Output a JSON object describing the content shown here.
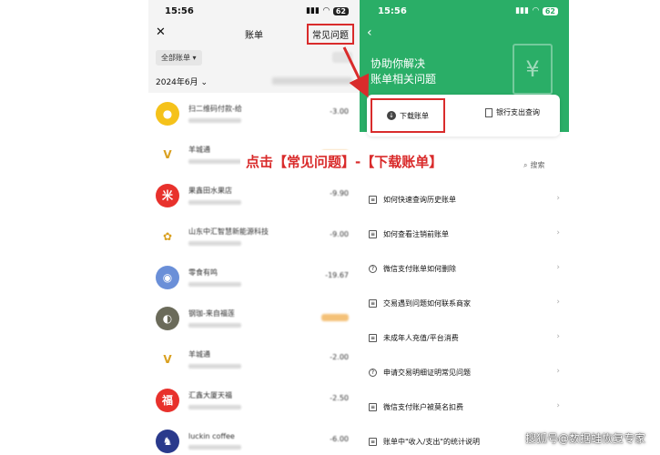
{
  "left_phone": {
    "time": "15:56",
    "battery": "62",
    "title": "账单",
    "faq_button": "常见问题",
    "filter_label": "全部账单",
    "month_label": "2024年6月",
    "transactions": [
      {
        "name": "扫二维码付款-给",
        "amount": "-3.00",
        "avatar_color": "#f5c21a",
        "avatar_glyph": "●"
      },
      {
        "name": "羊城通",
        "amount": "",
        "avatar_color": "#ffffff",
        "avatar_glyph": "V"
      },
      {
        "name": "果鑫田水果店",
        "amount": "-9.90",
        "avatar_color": "#e8312c",
        "avatar_glyph": "米"
      },
      {
        "name": "山东中汇智慧新能源科技",
        "amount": "-9.00",
        "avatar_color": "#ffffff",
        "avatar_glyph": "✿"
      },
      {
        "name": "零食有鸣",
        "amount": "-19.67",
        "avatar_color": "#6a8fd8",
        "avatar_glyph": "◉"
      },
      {
        "name": "钢珈-来自福莲",
        "amount": "",
        "avatar_color": "#6b6b5a",
        "avatar_glyph": "◐"
      },
      {
        "name": "羊城通",
        "amount": "-2.00",
        "avatar_color": "#ffffff",
        "avatar_glyph": "V"
      },
      {
        "name": "汇鑫大厦天福",
        "amount": "-2.50",
        "avatar_color": "#e8312c",
        "avatar_glyph": "福"
      },
      {
        "name": "luckin coffee",
        "amount": "-6.00",
        "avatar_color": "#2a3a8c",
        "avatar_glyph": "♞"
      }
    ]
  },
  "right_phone": {
    "time": "15:56",
    "battery": "62",
    "headline_line1": "协助你解决",
    "headline_line2": "账单相关问题",
    "doc_glyph": "¥",
    "download_button": "下载账单",
    "bank_query_button": "银行支出查询",
    "search_label": "搜索",
    "faq_items": [
      {
        "label": "如何快速查询历史账单",
        "icon": "doc-icon"
      },
      {
        "label": "如何查看注销前账单",
        "icon": "doc-icon"
      },
      {
        "label": "微信支付账单如何删除",
        "icon": "question-icon"
      },
      {
        "label": "交易遇到问题如何联系商家",
        "icon": "doc-icon"
      },
      {
        "label": "未成年人充值/平台消费",
        "icon": "doc-icon"
      },
      {
        "label": "申请交易明细证明常见问题",
        "icon": "question-icon"
      },
      {
        "label": "微信支付账户被莫名扣费",
        "icon": "doc-icon"
      },
      {
        "label": "账单中\"收入/支出\"的统计说明",
        "icon": "doc-icon"
      }
    ]
  },
  "annotation": {
    "instruction": "点击【常见问题】-【下载账单】",
    "arrow_color": "#d92b2b"
  },
  "watermark": "搜狐号@数据蛙恢复专家"
}
